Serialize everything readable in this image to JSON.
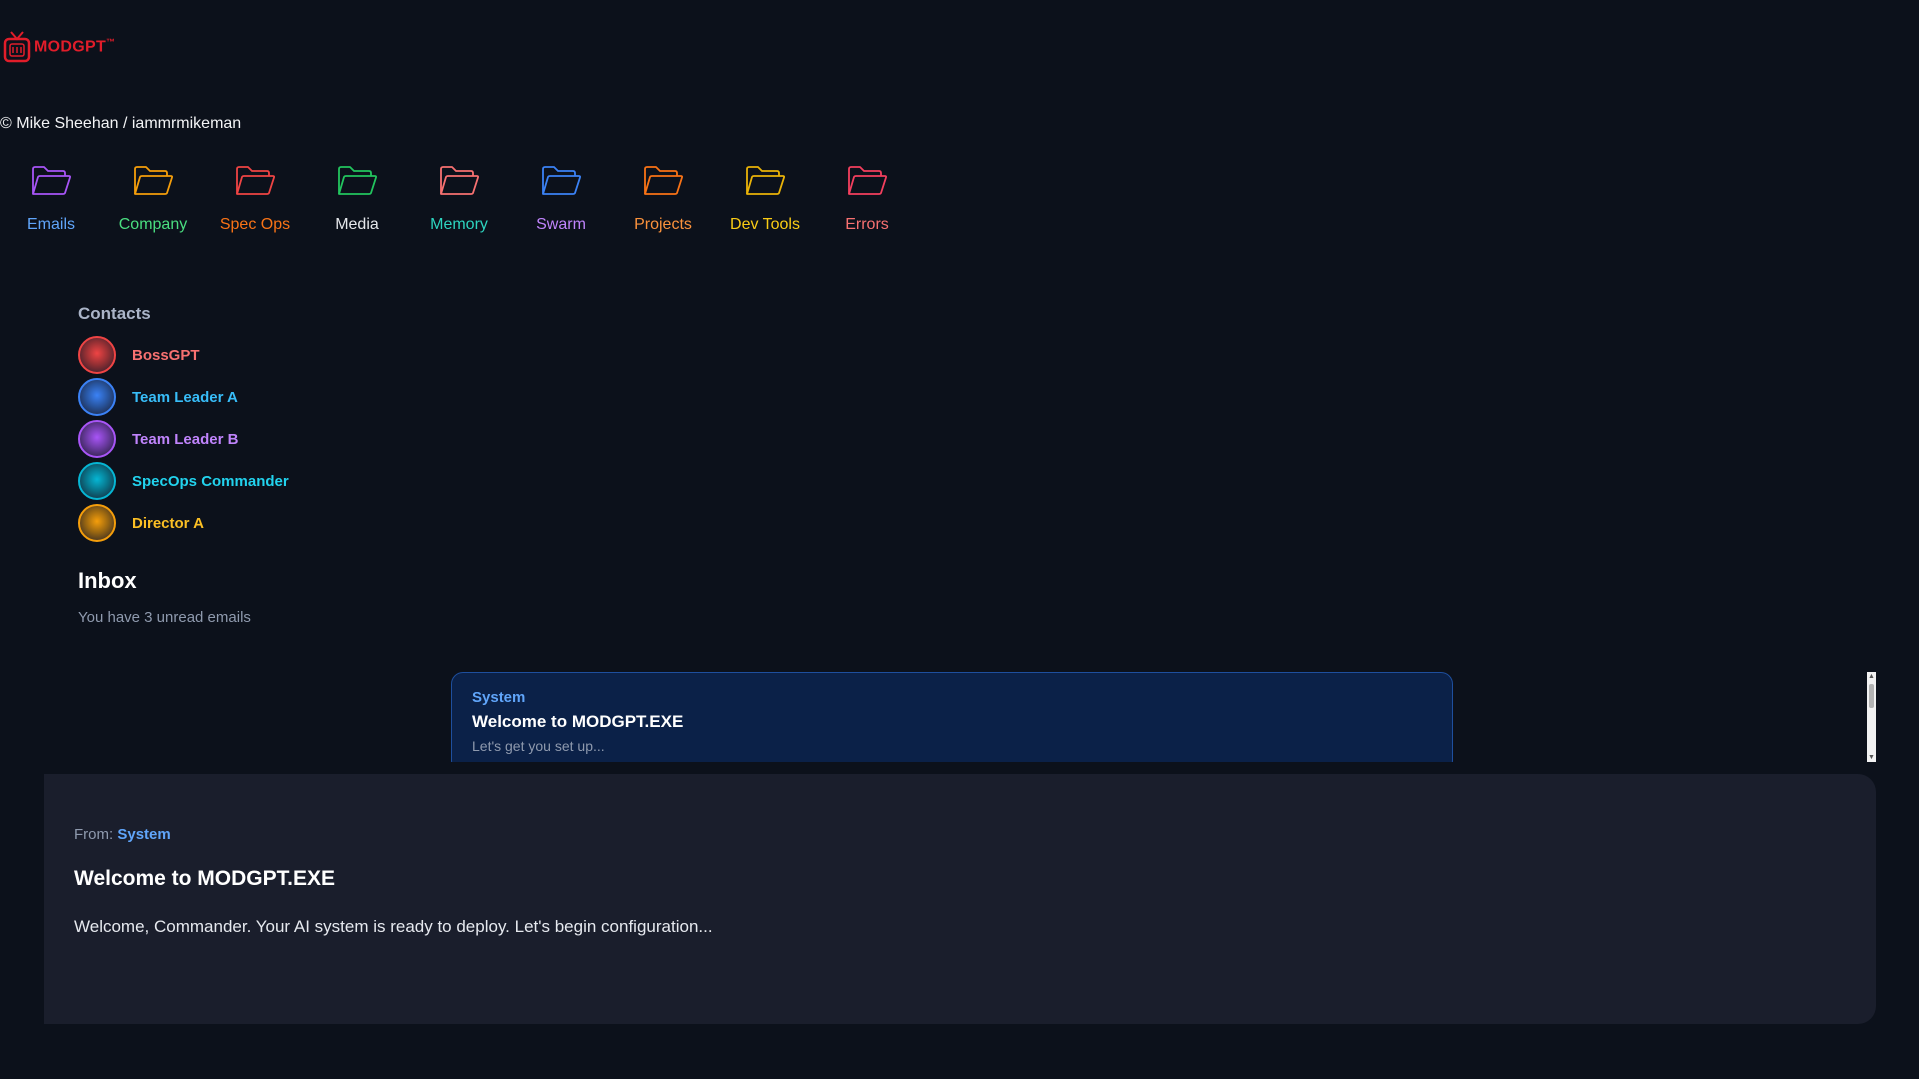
{
  "app": {
    "logo_text": "MODGPT",
    "trademark": "™"
  },
  "copyright": "© Mike Sheehan / iammrmikeman",
  "folders": [
    {
      "label": "Emails",
      "label_color": "#60a5fa",
      "icon_color": "#a855f7"
    },
    {
      "label": "Company",
      "label_color": "#4ade80",
      "icon_color": "#f59e0b"
    },
    {
      "label": "Spec Ops",
      "label_color": "#f97316",
      "icon_color": "#ef4444"
    },
    {
      "label": "Media",
      "label_color": "#e5e7eb",
      "icon_color": "#22c55e"
    },
    {
      "label": "Memory",
      "label_color": "#2dd4bf",
      "icon_color": "#f87171"
    },
    {
      "label": "Swarm",
      "label_color": "#c084fc",
      "icon_color": "#3b82f6"
    },
    {
      "label": "Projects",
      "label_color": "#fb923c",
      "icon_color": "#f97316"
    },
    {
      "label": "Dev Tools",
      "label_color": "#facc15",
      "icon_color": "#eab308"
    },
    {
      "label": "Errors",
      "label_color": "#f87171",
      "icon_color": "#f43f5e"
    }
  ],
  "contacts": {
    "title": "Contacts",
    "items": [
      {
        "name": "BossGPT",
        "color": "#f87171",
        "avatar_color": "#ef4444"
      },
      {
        "name": "Team Leader A",
        "color": "#38bdf8",
        "avatar_color": "#3b82f6"
      },
      {
        "name": "Team Leader B",
        "color": "#c084fc",
        "avatar_color": "#a855f7"
      },
      {
        "name": "SpecOps Commander",
        "color": "#22d3ee",
        "avatar_color": "#06b6d4"
      },
      {
        "name": "Director A",
        "color": "#fbbf24",
        "avatar_color": "#f59e0b"
      }
    ]
  },
  "inbox": {
    "title": "Inbox",
    "subtitle": "You have 3 unread emails",
    "emails": [
      {
        "sender": "System",
        "subject": "Welcome to MODGPT.EXE",
        "preview": "Let's get you set up..."
      }
    ]
  },
  "reader": {
    "from_label": "From:",
    "from_name": "System",
    "subject": "Welcome to MODGPT.EXE",
    "body": "Welcome, Commander. Your AI system is ready to deploy. Let's begin configuration..."
  }
}
